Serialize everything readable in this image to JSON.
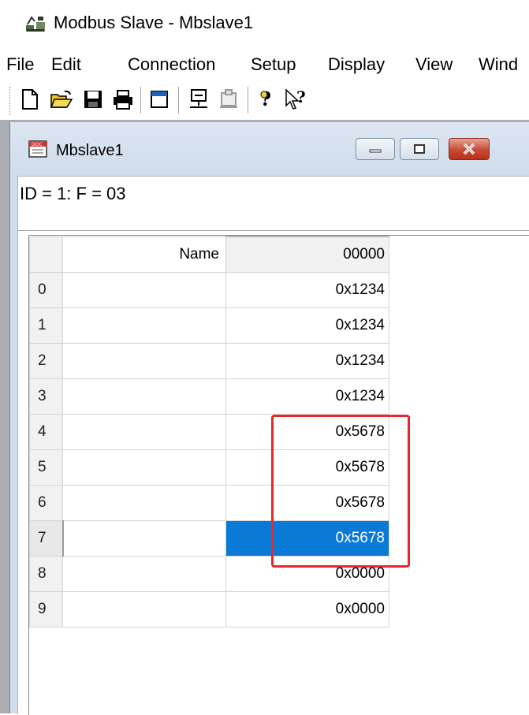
{
  "app": {
    "title": "Modbus Slave - Mbslave1"
  },
  "menu": [
    {
      "label": "File"
    },
    {
      "label": "Edit"
    },
    {
      "label": "Connection"
    },
    {
      "label": "Setup"
    },
    {
      "label": "Display"
    },
    {
      "label": "View"
    },
    {
      "label": "Wind"
    }
  ],
  "toolbar": {
    "icons": [
      "new-icon",
      "open-icon",
      "save-icon",
      "print-icon",
      "window-icon",
      "connect-icon",
      "disconnect-icon",
      "help-icon",
      "context-help-icon"
    ]
  },
  "child_window": {
    "title": "Mbslave1",
    "status": "ID = 1: F = 03"
  },
  "grid": {
    "header_name": "Name",
    "header_address": "00000",
    "rows": [
      {
        "index": "0",
        "name": "",
        "value": "0x1234"
      },
      {
        "index": "1",
        "name": "",
        "value": "0x1234"
      },
      {
        "index": "2",
        "name": "",
        "value": "0x1234"
      },
      {
        "index": "3",
        "name": "",
        "value": "0x1234"
      },
      {
        "index": "4",
        "name": "",
        "value": "0x5678"
      },
      {
        "index": "5",
        "name": "",
        "value": "0x5678"
      },
      {
        "index": "6",
        "name": "",
        "value": "0x5678"
      },
      {
        "index": "7",
        "name": "",
        "value": "0x5678"
      },
      {
        "index": "8",
        "name": "",
        "value": "0x0000"
      },
      {
        "index": "9",
        "name": "",
        "value": "0x0000"
      }
    ],
    "selected_row": 7,
    "selection_color": "#0a7ad6"
  },
  "annotation": {
    "color": "#e8262b"
  }
}
